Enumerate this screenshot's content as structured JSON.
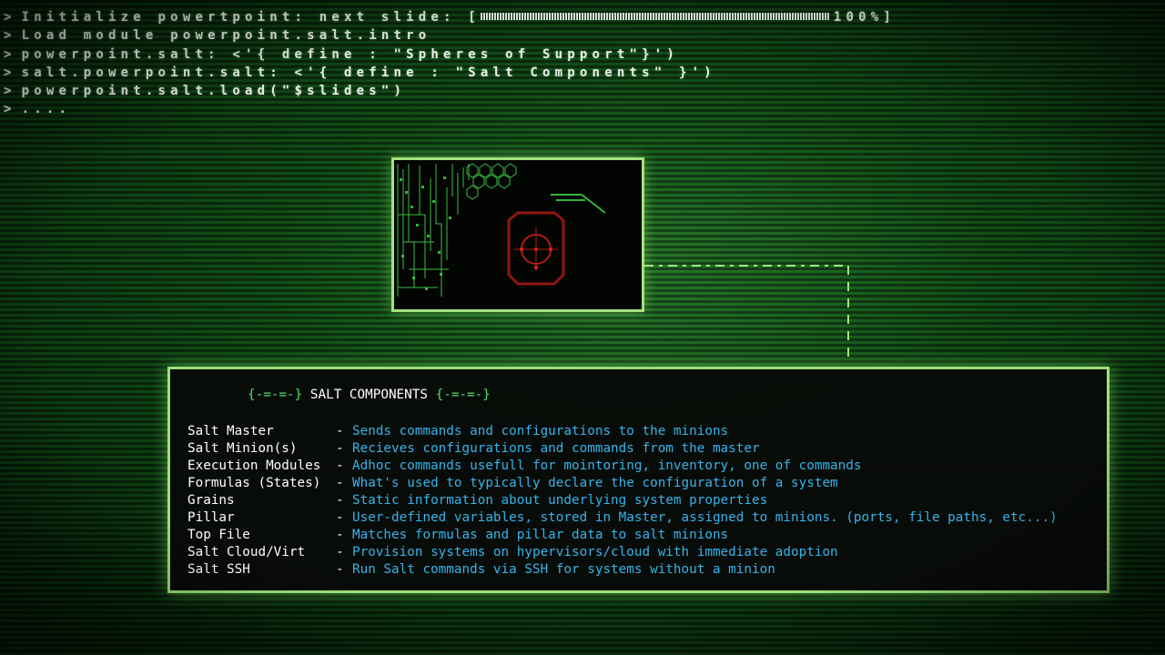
{
  "terminal": {
    "prompt": ">",
    "lines": [
      {
        "text": "Initialize powertpoint: next slide: [",
        "suffix": "100%]",
        "progress": 1.0
      },
      {
        "text": "Load module powerpoint.salt.intro"
      },
      {
        "text": "powerpoint.salt: <'{ define : \"Spheres of Support\"}')"
      },
      {
        "text": "salt.powerpoint.salt: <'{ define : \"Salt Components\" }')"
      },
      {
        "text": "powerpoint.salt.load(\"$slides\")"
      },
      {
        "text": "...."
      }
    ]
  },
  "panel": {
    "title_brace_left": "{-=-=-}",
    "title": "SALT COMPONENTS",
    "title_brace_right": "{-=-=-}",
    "separator": "-",
    "components": [
      {
        "name": "Salt Master",
        "desc": "Sends commands and configurations to the minions"
      },
      {
        "name": "Salt Minion(s)",
        "desc": "Recieves configurations and commands from the master"
      },
      {
        "name": "Execution Modules",
        "desc": "Adhoc commands usefull for mointoring, inventory, one of commands"
      },
      {
        "name": "Formulas (States)",
        "desc": "What's used to typically declare the configuration of a system"
      },
      {
        "name": "Grains",
        "desc": "Static information about underlying system properties"
      },
      {
        "name": "Pillar",
        "desc": "User-defined variables, stored in Master, assigned to minions. (ports, file paths, etc...)"
      },
      {
        "name": "Top File",
        "desc": "Matches formulas and pillar data to salt minions"
      },
      {
        "name": "Salt Cloud/Virt",
        "desc": "Provision systems on hypervisors/cloud with immediate adoption"
      },
      {
        "name": "Salt SSH",
        "desc": "Run Salt commands via SSH for systems without a minion"
      }
    ]
  },
  "colors": {
    "terminal_text": "#e8efe8",
    "panel_border": "#9ee07a",
    "brace": "#4ee06a",
    "description": "#35b4ec",
    "preview_red": "#b51a14",
    "preview_green": "#3fd24a"
  },
  "preview": {
    "icon": "circuit-target-graphic"
  }
}
